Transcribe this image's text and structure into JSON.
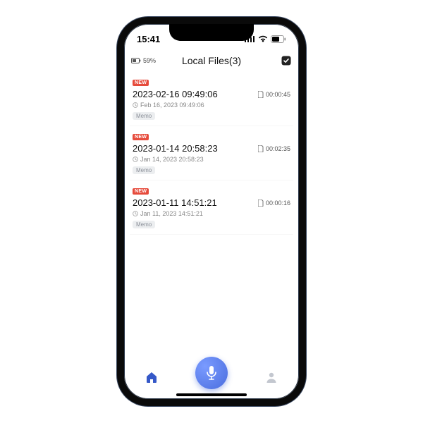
{
  "status": {
    "time": "15:41",
    "battery_pct": "59%"
  },
  "header": {
    "title": "Local Files(3)"
  },
  "files": [
    {
      "new_label": "NEW",
      "title": "2023-02-16 09:49:06",
      "duration": "00:00:45",
      "subtitle": "Feb 16, 2023 09:49:06",
      "memo": "Memo"
    },
    {
      "new_label": "NEW",
      "title": "2023-01-14 20:58:23",
      "duration": "00:02:35",
      "subtitle": "Jan 14, 2023 20:58:23",
      "memo": "Memo"
    },
    {
      "new_label": "NEW",
      "title": "2023-01-11 14:51:21",
      "duration": "00:00:16",
      "subtitle": "Jan 11, 2023 14:51:21",
      "memo": "Memo"
    }
  ]
}
